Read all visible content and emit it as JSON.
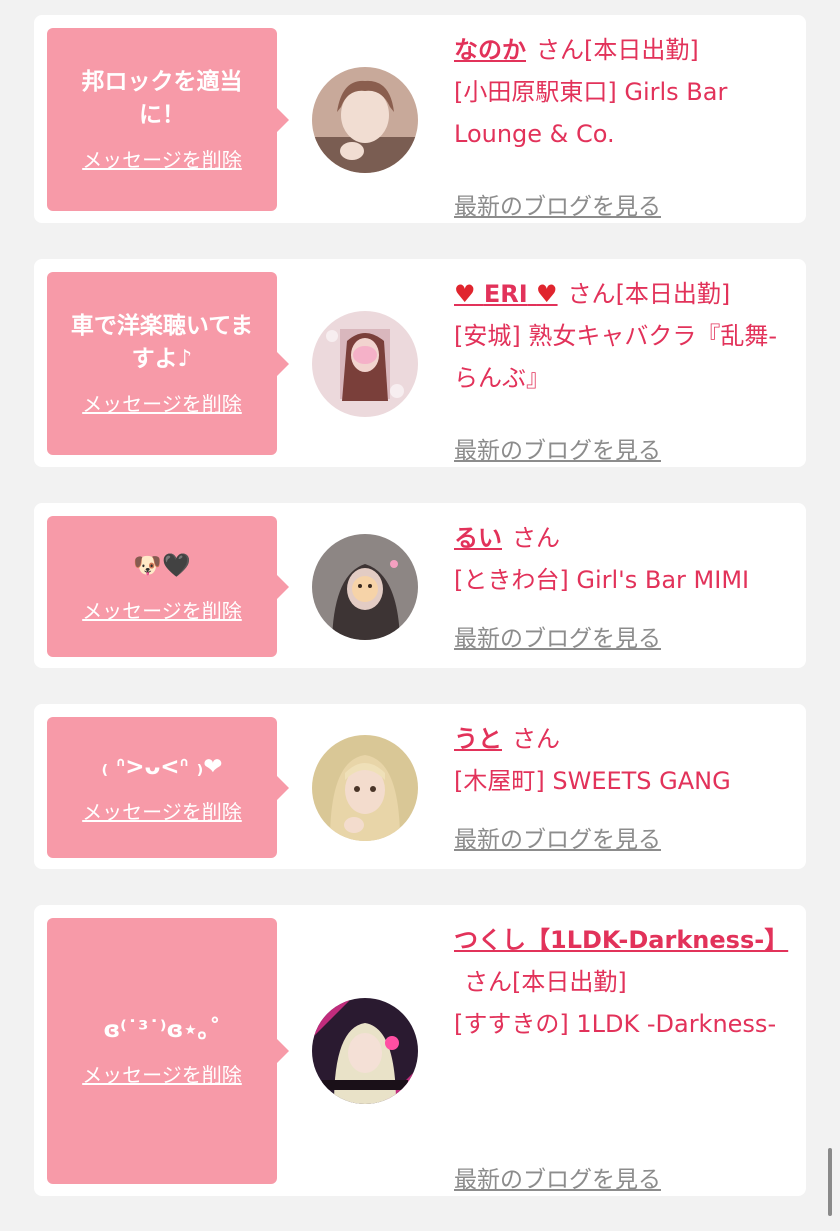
{
  "common": {
    "delete_label": "メッセージを削除",
    "san_label": "さん",
    "blog_label": "最新のブログを見る"
  },
  "cards": [
    {
      "message": "邦ロックを適当に！",
      "name": "なのか",
      "status": "[本日出勤]",
      "shop": "[小田原駅東口] Girls Bar Lounge & Co."
    },
    {
      "message": "車で洋楽聴いてますよ♪",
      "name_heart_left": "♥",
      "name": "ERI",
      "name_heart_right": "♥",
      "status": "[本日出勤]",
      "shop": "[安城] 熟女キャバクラ『乱舞-らんぶ』"
    },
    {
      "message": "🐶🖤",
      "name": "るい",
      "status": "",
      "shop": "[ときわ台] Girl's Bar MIMI"
    },
    {
      "message": "₍ ᐢ>ᴗ<ᐢ ₎❤",
      "name": "うと",
      "status": "",
      "shop": "[木屋町] SWEETS GANG"
    },
    {
      "message": "ɞ⁽˙³˙⁾ɞ⋆｡˚",
      "name": "つくし【1LDK-Darkness-】",
      "status": "[本日出勤]",
      "shop": "[すすきの] 1LDK -Darkness-"
    }
  ],
  "colors": {
    "accent": "#e2325a",
    "bubble": "#f79aa8",
    "background": "#f2f2f2",
    "link_gray": "#8c8c8c"
  }
}
